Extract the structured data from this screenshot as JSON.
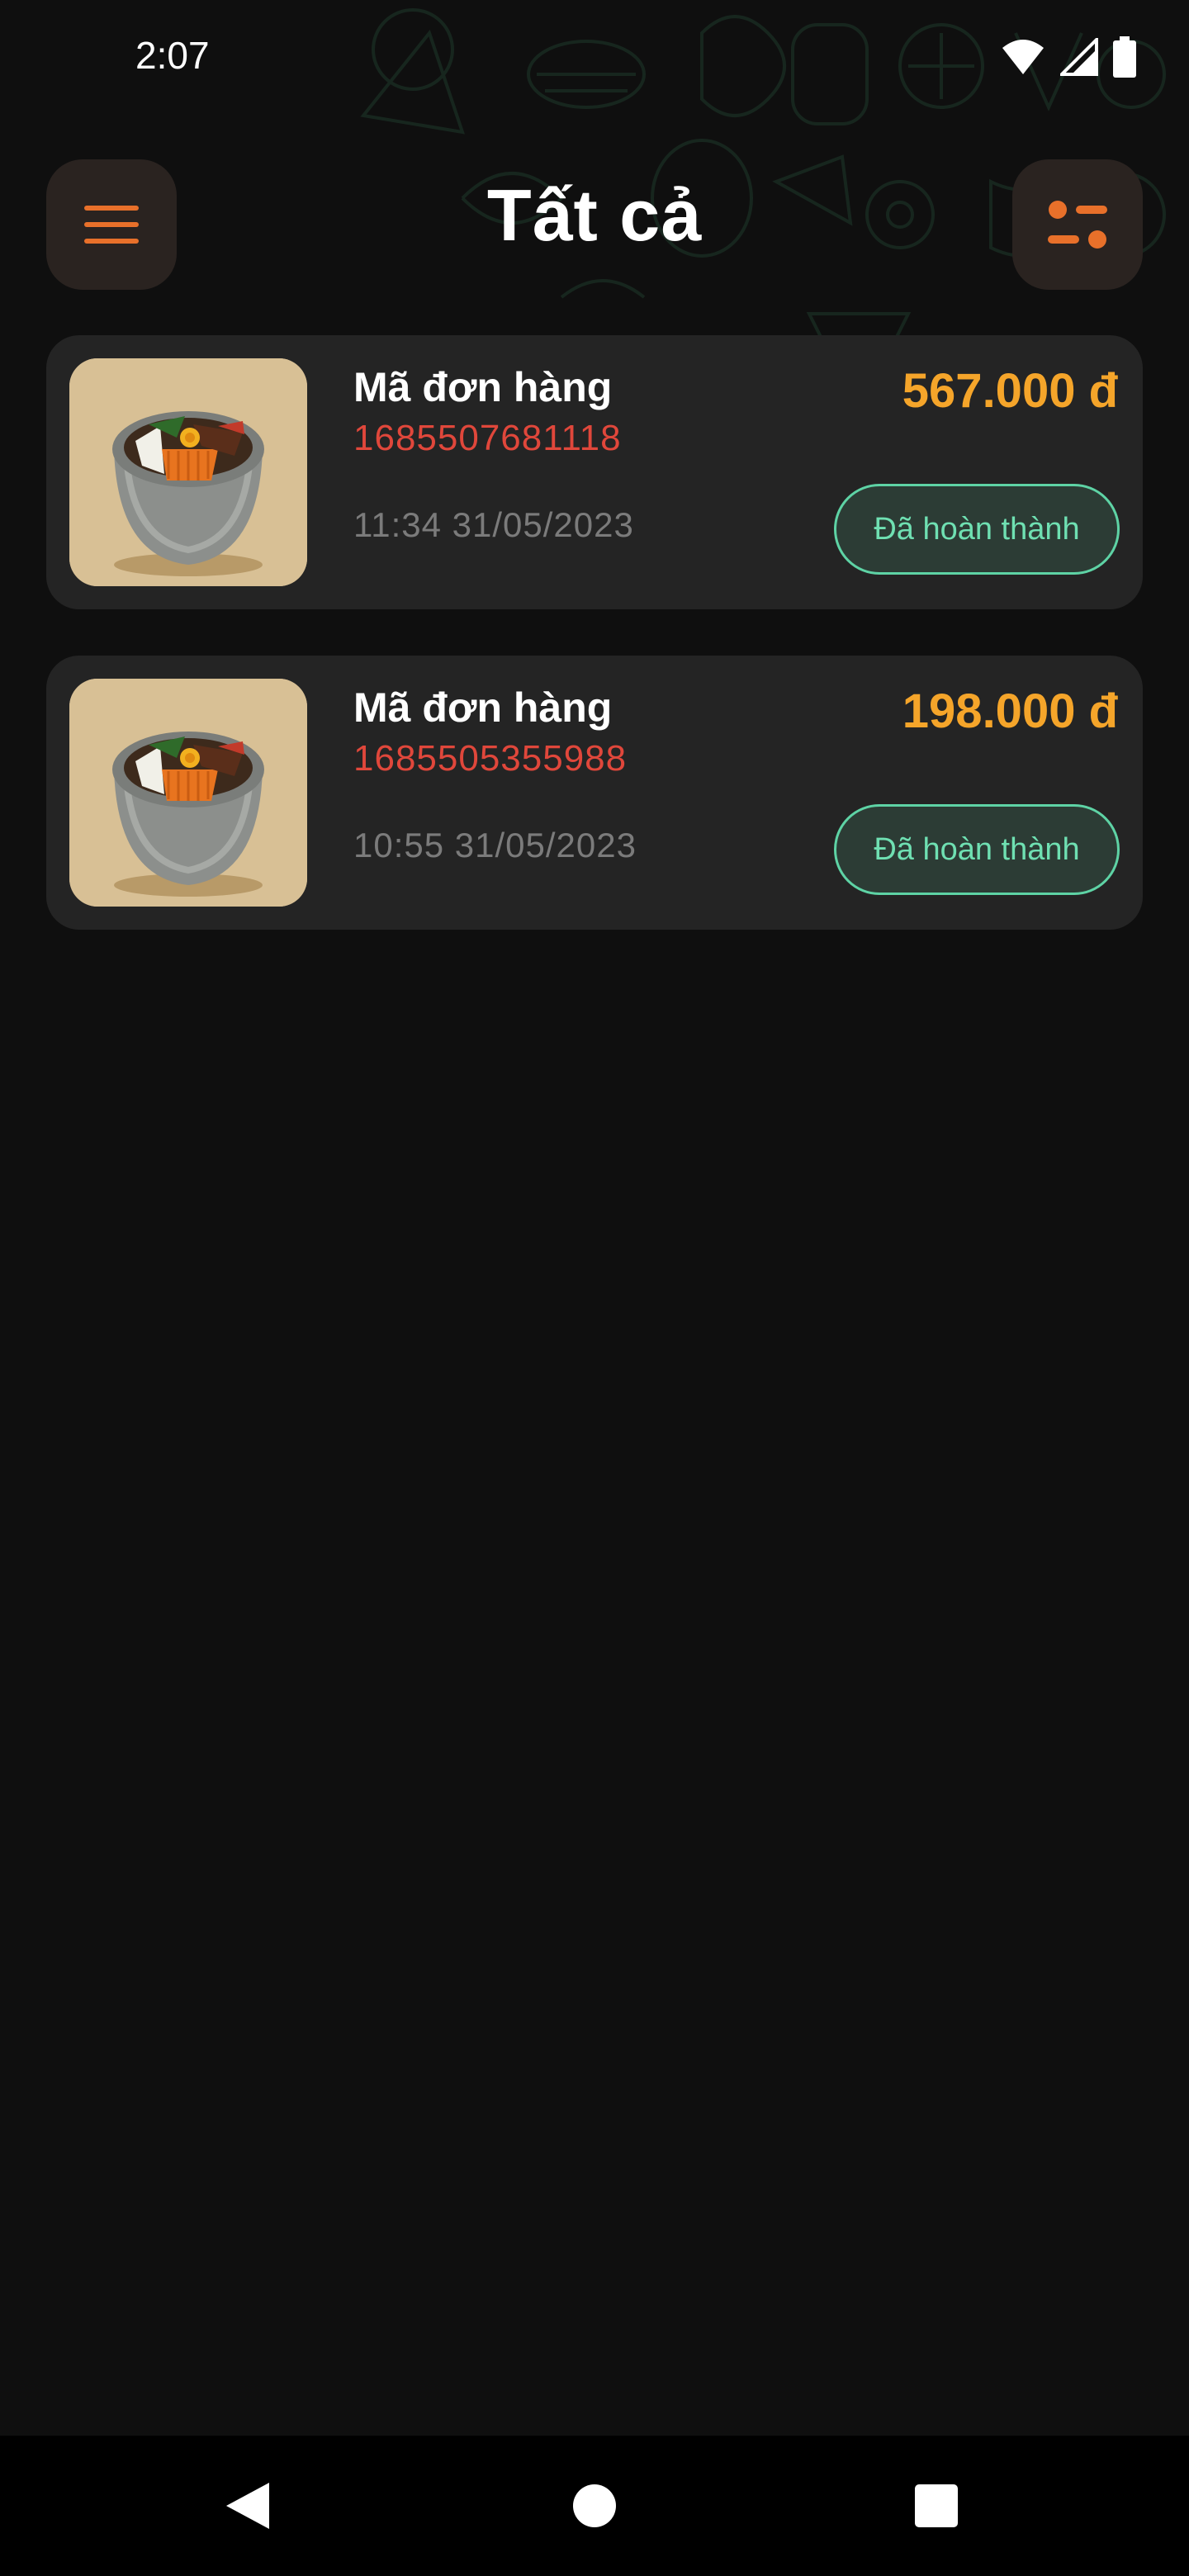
{
  "status_bar": {
    "time": "2:07",
    "icons": [
      "wifi-icon",
      "signal-icon",
      "battery-icon"
    ]
  },
  "header": {
    "title": "Tất cả",
    "menu_icon": "hamburger-menu-icon",
    "filter_icon": "filter-sliders-icon"
  },
  "orders": [
    {
      "label": "Mã đơn hàng",
      "code": "1685507681118",
      "time": "11:34 31/05/2023",
      "price": "567.000 đ",
      "status": "Đã hoàn thành",
      "image": "bibimbap-stone-bowl"
    },
    {
      "label": "Mã đơn hàng",
      "code": "1685505355988",
      "time": "10:55 31/05/2023",
      "price": "198.000 đ",
      "status": "Đã hoàn thành",
      "image": "bibimbap-stone-bowl"
    }
  ],
  "nav_bar": {
    "icons": [
      "back-icon",
      "home-icon",
      "recents-icon"
    ]
  },
  "colors": {
    "background": "#0f0f0f",
    "card": "#242424",
    "accent_orange": "#e8702a",
    "price": "#f5a52a",
    "order_code": "#e0473b",
    "status_green": "#5ed3a5"
  }
}
